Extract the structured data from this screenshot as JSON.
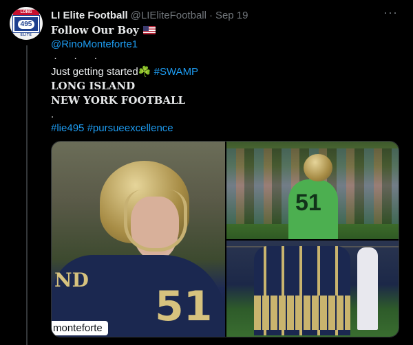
{
  "tweet": {
    "author_name": "LI Elite Football",
    "author_handle": "@LIEliteFootball",
    "separator": "·",
    "timestamp": "Sep 19",
    "more_label": "···",
    "avatar": {
      "top_text": "LONG ISLAND",
      "number": "495",
      "bottom_text": "ELITE"
    },
    "lines": {
      "follow": "Follow Our Boy",
      "mention": "@RinoMonteforte1",
      "dots": "· · ·",
      "started": "Just getting started",
      "clover": "☘️",
      "swamp_tag": "#SWAMP",
      "li": "LONG ISLAND",
      "ny": "NEW YORK FOOTBALL",
      "single_dot": ".",
      "hashtag1": "#lie495",
      "hashtag2": "#pursueexcellence"
    },
    "media": {
      "main_tag": "monteforte",
      "main_number": "51",
      "top_right_number": "51"
    }
  }
}
